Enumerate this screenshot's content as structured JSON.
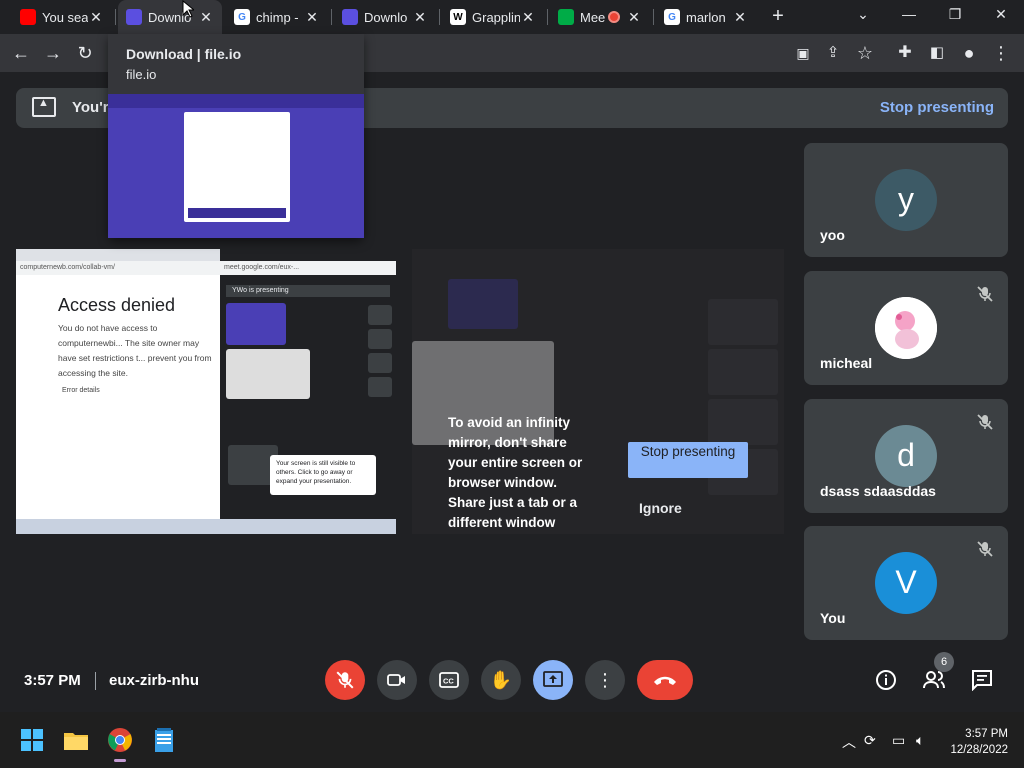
{
  "browser": {
    "tabs": [
      {
        "title": "You sear",
        "favicon": "youtube-icon",
        "color": "#ff0000"
      },
      {
        "title": "Downlo",
        "favicon": "fileio-icon",
        "color": "#5b4fe0"
      },
      {
        "title": "chimp -",
        "favicon": "google-icon",
        "color": "#ffffff"
      },
      {
        "title": "Downlo",
        "favicon": "fileio-icon",
        "color": "#5b4fe0"
      },
      {
        "title": "Grapplin",
        "favicon": "wikipedia-icon",
        "color": "#ffffff"
      },
      {
        "title": "Mee",
        "favicon": "meet-icon",
        "color": "#00ac47"
      },
      {
        "title": "marlon",
        "favicon": "google-icon",
        "color": "#ffffff"
      }
    ],
    "hovercard": {
      "title": "Download | file.io",
      "domain": "file.io"
    }
  },
  "banner": {
    "text": "You're",
    "stop_label": "Stop presenting"
  },
  "shared_screen": {
    "heading": "Access denied",
    "body": "You do not have access to computernewbi... The site owner may have set restrictions t... prevent you from accessing the site.",
    "error_details": "Error details",
    "address": "computernewb.com/collab-vm/",
    "address2": "meet.google.com/eux-...",
    "presenting": "YWo is presenting",
    "tip": "Your screen is still visible to others. Click to go away or expand your presentation."
  },
  "mirror": {
    "message": "To avoid an infinity mirror, don't share your entire screen or browser window. Share just a tab or a different window",
    "stop_label": "Stop presenting",
    "ignore_label": "Ignore"
  },
  "participants": [
    {
      "name": "yoo",
      "initial": "y",
      "avatar_color": "#3d5a66",
      "muted": false
    },
    {
      "name": "micheal",
      "initial": "",
      "avatar_color": "#ffffff",
      "muted": true
    },
    {
      "name": "dsass sdaasddas",
      "initial": "d",
      "avatar_color": "#6b8a94",
      "muted": true
    },
    {
      "name": "You",
      "initial": "V",
      "avatar_color": "#1a8fd8",
      "muted": true
    }
  ],
  "meeting": {
    "time": "3:57 PM",
    "code": "eux-zirb-nhu",
    "participant_count": "6"
  },
  "taskbar": {
    "time": "3:57 PM",
    "date": "12/28/2022"
  },
  "colors": {
    "accent": "#8ab4f8",
    "danger": "#ea4335",
    "tile": "#3c4043"
  }
}
